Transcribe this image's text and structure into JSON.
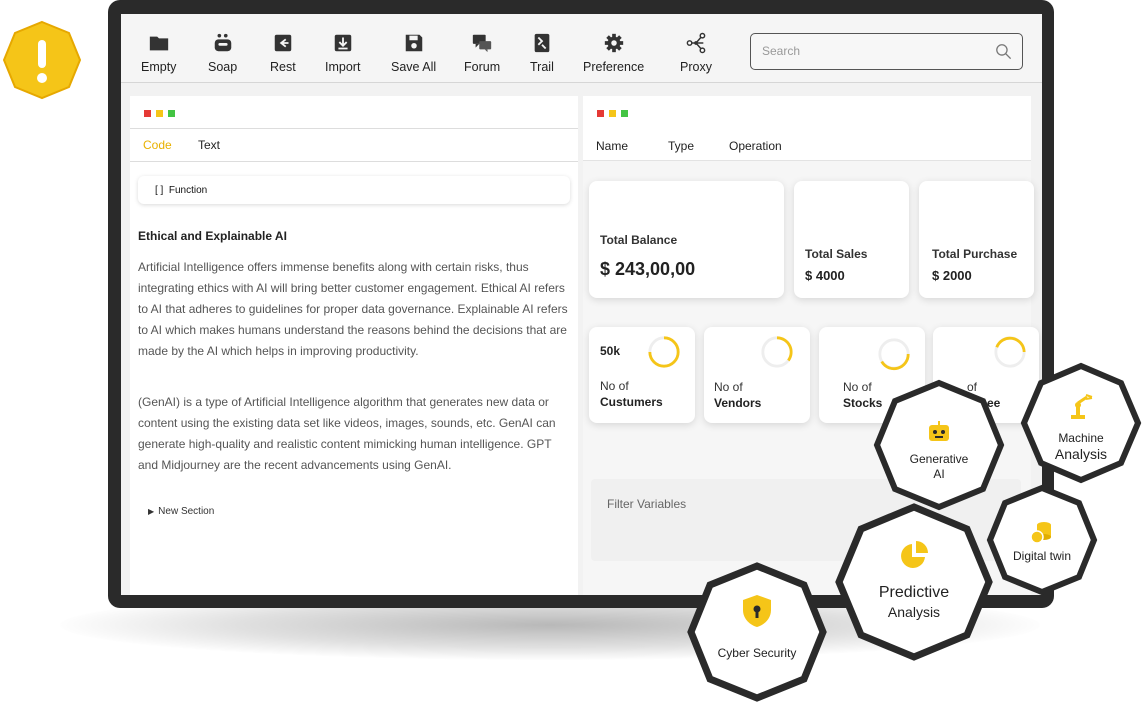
{
  "toolbar": {
    "items": [
      {
        "label": "Empty",
        "icon": "folder-icon"
      },
      {
        "label": "Soap",
        "icon": "robot-icon"
      },
      {
        "label": "Rest",
        "icon": "rest-icon"
      },
      {
        "label": "Import",
        "icon": "import-icon"
      },
      {
        "label": "Save All",
        "icon": "save-icon"
      },
      {
        "label": "Forum",
        "icon": "forum-icon"
      },
      {
        "label": "Trail",
        "icon": "trail-icon"
      },
      {
        "label": "Preference",
        "icon": "gear-icon"
      },
      {
        "label": "Proxy",
        "icon": "share-icon"
      }
    ],
    "search_placeholder": "Search"
  },
  "editor": {
    "tabs": [
      {
        "label": "Code",
        "active": true
      },
      {
        "label": "Text",
        "active": false
      }
    ],
    "function_label": "[ ]  Function",
    "heading": "Ethical and Explainable AI",
    "paragraph1": "Artificial Intelligence offers immense benefits along with certain risks, thus integrating ethics with AI will bring better customer engagement. Ethical AI refers to AI that adheres to guidelines for proper data governance. Explainable AI refers to AI which makes humans understand the reasons behind the decisions that are made by the AI which helps in improving productivity.",
    "paragraph2": "(GenAI) is a type of Artificial Intelligence algorithm that generates new data or content using the existing data set like videos, images, sounds, etc. GenAI can generate high-quality and realistic content mimicking human intelligence. GPT and Midjourney are the recent advancements using GenAI.",
    "new_section": "New Section"
  },
  "dashboard": {
    "columns": [
      "Name",
      "Type",
      "Operation"
    ],
    "balance": {
      "title": "Total Balance",
      "value": "$ 243,00,00"
    },
    "sales": {
      "title": "Total Sales",
      "value": "$ 4000"
    },
    "purchase": {
      "title": "Total Purchase",
      "value": "$ 2000"
    },
    "stats": [
      {
        "value": "50k",
        "line1": "No of",
        "line2": "Custumers"
      },
      {
        "value": "",
        "line1": "No of",
        "line2": "Vendors"
      },
      {
        "value": "",
        "line1": "No of",
        "line2": "Stocks"
      },
      {
        "value": "",
        "line1": "of",
        "line2": "ee"
      }
    ],
    "filter_label": "Filter Variables"
  },
  "badges": [
    {
      "line1": "Generative",
      "line2": "AI",
      "icon": "robot-head-icon"
    },
    {
      "line1": "Machine",
      "line2": "Analysis",
      "icon": "robotic-arm-icon"
    },
    {
      "line1": "Digital twin",
      "line2": "",
      "icon": "coins-icon"
    },
    {
      "line1": "Predictive",
      "line2": "Analysis",
      "icon": "pie-chart-icon"
    },
    {
      "line1": "Cyber Security",
      "line2": "",
      "icon": "shield-lock-icon"
    }
  ],
  "colors": {
    "accent": "#f5c518",
    "dark": "#2a2a2a",
    "dot_red": "#e53935",
    "dot_yellow": "#f5c518",
    "dot_green": "#43c443"
  }
}
